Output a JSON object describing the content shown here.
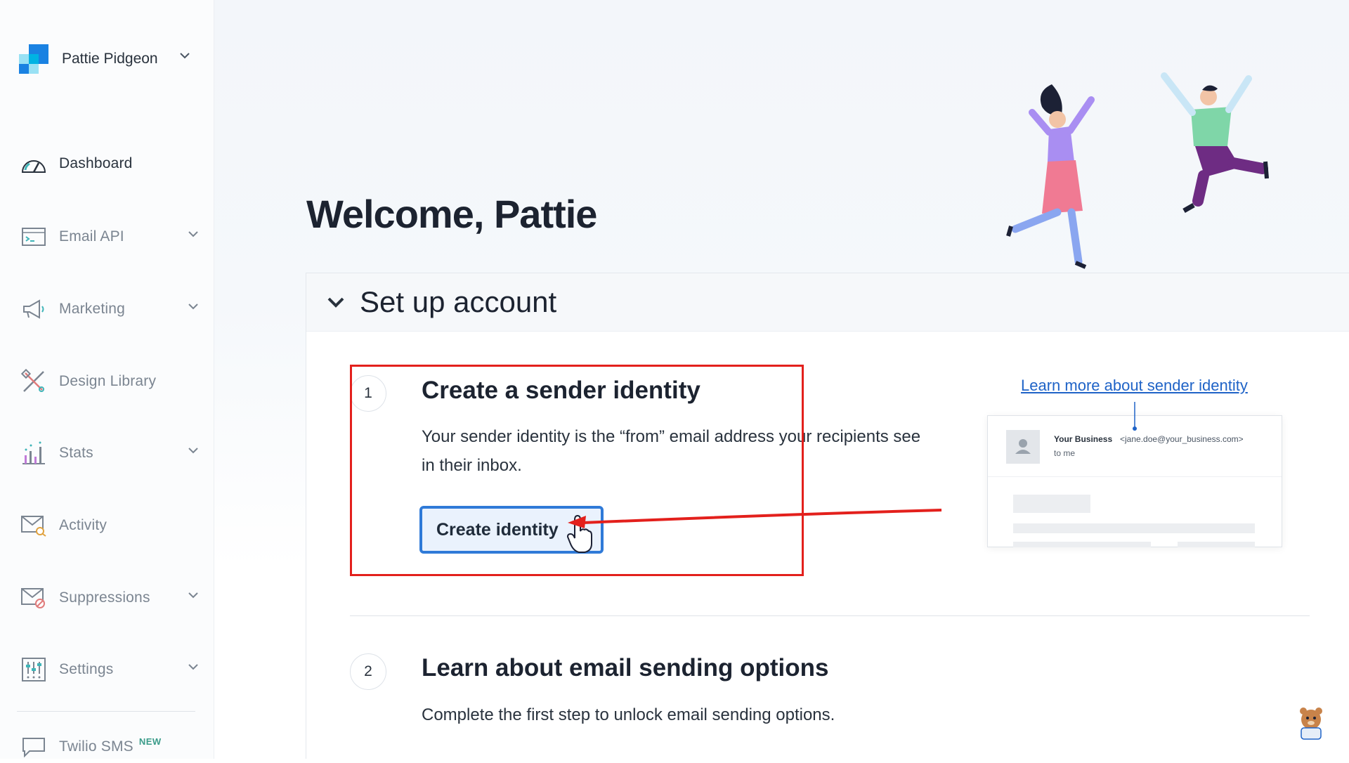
{
  "account": {
    "name": "Pattie Pidgeon"
  },
  "nav": {
    "dashboard": "Dashboard",
    "email_api": "Email API",
    "marketing": "Marketing",
    "design_library": "Design Library",
    "stats": "Stats",
    "activity": "Activity",
    "suppressions": "Suppressions",
    "settings": "Settings",
    "twilio_sms": "Twilio SMS",
    "twilio_badge": "NEW"
  },
  "main": {
    "welcome": "Welcome, Pattie",
    "setup_title": "Set up account",
    "step1": {
      "number": "1",
      "title": "Create a sender identity",
      "description": "Your sender identity is the “from” email address your recipients see in their inbox.",
      "button": "Create identity",
      "learn_link": "Learn more about sender identity",
      "preview": {
        "business": "Your Business",
        "address": "<jane.doe@your_business.com>",
        "to": "to me"
      }
    },
    "step2": {
      "number": "2",
      "title": "Learn about email sending options",
      "description": "Complete the first step to unlock email sending options."
    }
  },
  "colors": {
    "accent_blue": "#2f7ad8",
    "highlight_red": "#e3201c",
    "link_blue": "#1f63c7",
    "text_dark": "#1c2330",
    "text_muted": "#7b8591"
  }
}
